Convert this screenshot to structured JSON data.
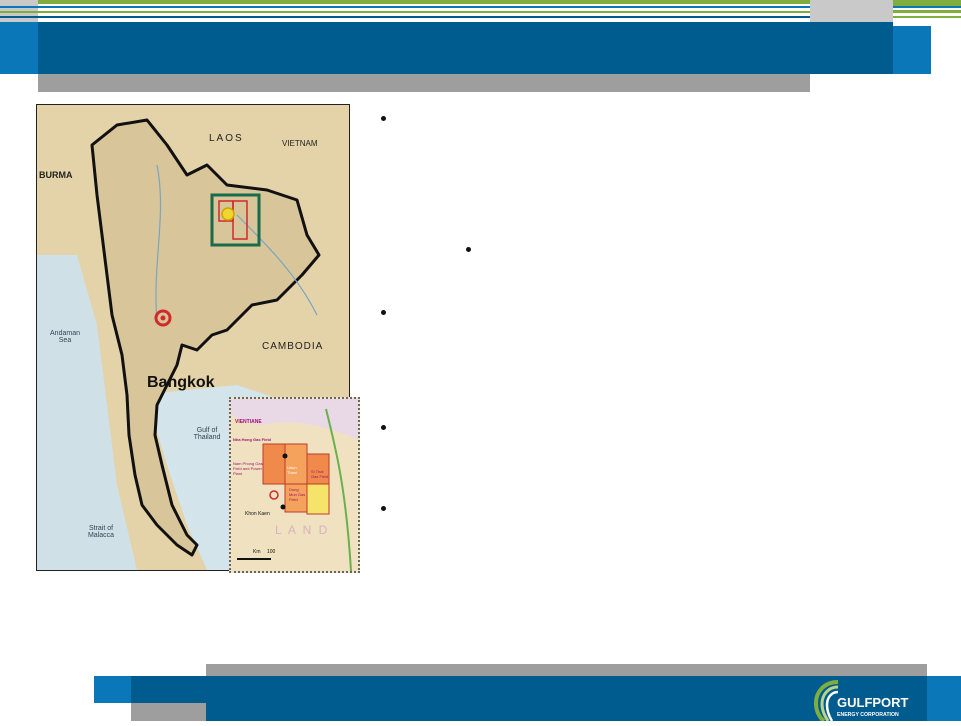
{
  "map": {
    "labels": {
      "laos": "LAOS",
      "vietnam": "VIETNAM",
      "burma": "BURMA",
      "cambodia": "CAMBODIA",
      "bangkok": "Bangkok",
      "andaman_sea": "Andaman Sea",
      "gulf_of_thailand": "Gulf of Thailand",
      "strait_malacca": "Strait of Malacca"
    },
    "inset": {
      "vientiane": "VIENTIANE",
      "nam_phong": "Nam Phong Gas Field and Power Plant",
      "khon_kaen": "Khon Kaen",
      "dong_mun": "Dong Mun Gas Field",
      "udon_thani": "Udon Thani",
      "si_that": "Si That Gas Field",
      "hong_gas": "Nha Hong Gas Field",
      "scale_km": "Km",
      "scale_100": "100",
      "land": "L A N D"
    }
  },
  "logo": {
    "name": "GULFPORT",
    "sub": "ENERGY CORPORATION"
  },
  "colors": {
    "header_blue": "#005b8f",
    "accent_blue": "#0a78b8",
    "accent_green": "#7fae3e",
    "bar_gray": "#9e9e9e"
  }
}
